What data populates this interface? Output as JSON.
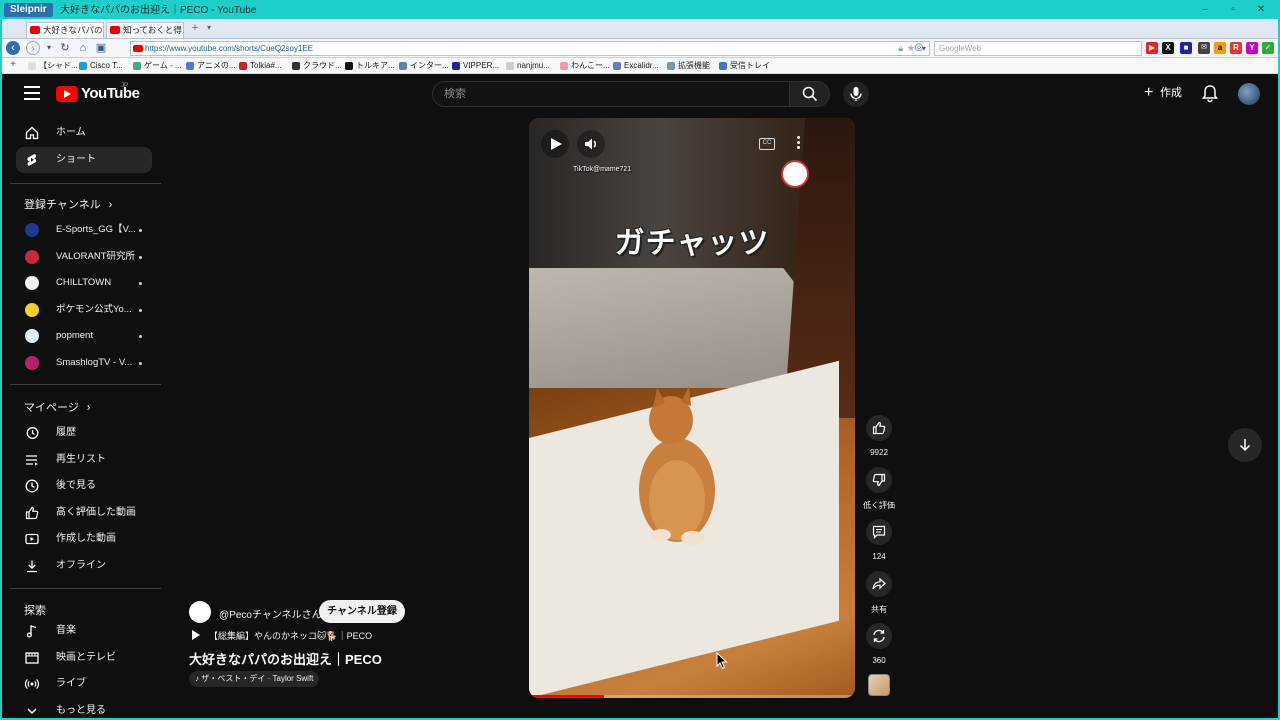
{
  "browser": {
    "app_name": "Sleipnir",
    "window_title": "大好きなパパのお出迎え｜PECO - YouTube",
    "tabs": [
      {
        "label": "大好きなパパのお..."
      },
      {
        "label": "知っておくと得す..."
      }
    ],
    "url": "https://www.youtube.com/shorts/CueQ2soy1EE",
    "search_placeholder": "GoogleWeb",
    "badge_count": "103",
    "bookmarks": [
      "【シャド...",
      "Cisco T...",
      "ゲーム - ...",
      "アニメの...",
      "Tolkia#...",
      "クラウド...",
      "トルキア...",
      "インター...",
      "VIPPER...",
      "nanjmu...",
      "わんこー...",
      "Excalidr...",
      "拡張機能",
      "受信トレイ"
    ]
  },
  "youtube": {
    "logo_text": "YouTube",
    "logo_region": "JP",
    "search_placeholder": "検索",
    "create_label": "作成",
    "sidebar": {
      "home": "ホーム",
      "shorts": "ショート",
      "subs_header": "登録チャンネル",
      "channels": [
        {
          "name": "E-Sports_GG【V...",
          "color": "#1f3a8c"
        },
        {
          "name": "VALORANT研究所",
          "color": "#c42a3b"
        },
        {
          "name": "CHILLTOWN",
          "color": "#f2f2f2"
        },
        {
          "name": "ポケモン公式Yo...",
          "color": "#f5d21e"
        },
        {
          "name": "popment",
          "color": "#e9f2ff"
        },
        {
          "name": "SmashlogTV - V...",
          "color": "#b3226b"
        }
      ],
      "you_header": "マイページ",
      "you_items": [
        "履歴",
        "再生リスト",
        "後で見る",
        "高く評価した動画",
        "作成した動画",
        "オフライン"
      ],
      "explore_header": "探索",
      "explore_items": [
        "音楽",
        "映画とテレビ",
        "ライブ",
        "もっと見る"
      ]
    },
    "short": {
      "caption": "ガチャッツ",
      "watermark": "TikTok@mame721",
      "progress": 0.23,
      "likes": "9922",
      "dislike_label": "低く評価",
      "comments": "124",
      "share_label": "共有",
      "remix_count": "360",
      "channel_handle": "@Pecoチャンネルさん",
      "subscribe_label": "チャンネル登録",
      "playlist": "【総集編】やんのかネッコ🐱🐕｜PECO",
      "title": "大好きなパパのお出迎え｜PECO",
      "music": "ザ・ベスト・デイ · Taylor Swift"
    }
  }
}
